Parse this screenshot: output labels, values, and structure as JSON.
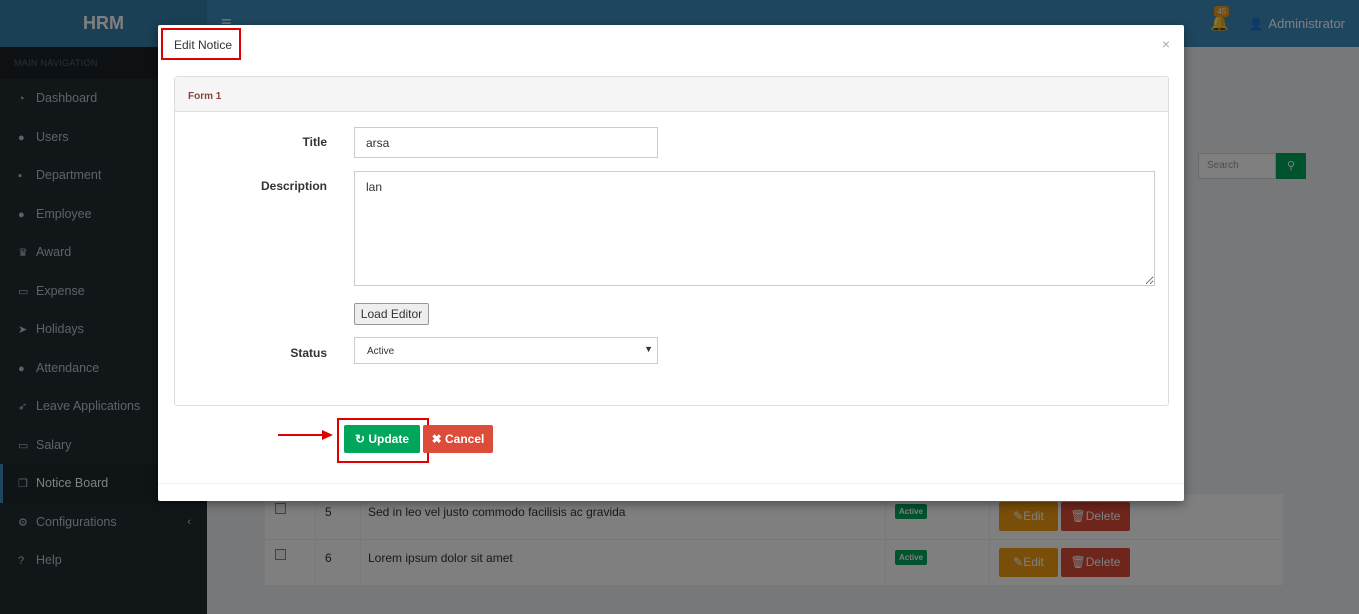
{
  "app": {
    "logo": "HRM"
  },
  "header": {
    "notifications_count": "45",
    "user_name": "Administrator"
  },
  "sidebar": {
    "section_title": "MAIN NAVIGATION",
    "items": [
      {
        "label": "Dashboard",
        "icon": "dashboard-icon"
      },
      {
        "label": "Users",
        "icon": "user-icon"
      },
      {
        "label": "Department",
        "icon": "briefcase-icon"
      },
      {
        "label": "Employee",
        "icon": "users-icon"
      },
      {
        "label": "Award",
        "icon": "trophy-icon"
      },
      {
        "label": "Expense",
        "icon": "money-icon"
      },
      {
        "label": "Holidays",
        "icon": "paper-plane-icon"
      },
      {
        "label": "Attendance",
        "icon": "user-icon"
      },
      {
        "label": "Leave Applications",
        "icon": "rocket-icon"
      },
      {
        "label": "Salary",
        "icon": "money-icon"
      },
      {
        "label": "Notice Board",
        "icon": "files-icon"
      },
      {
        "label": "Configurations",
        "icon": "cogs-icon"
      },
      {
        "label": "Help",
        "icon": "question-icon"
      }
    ]
  },
  "search": {
    "placeholder": "Search"
  },
  "table": {
    "rows": [
      {
        "num": "5",
        "title": "Sed in leo vel justo commodo facilisis ac gravida",
        "status": "Active",
        "edit": "Edit",
        "delete": "Delete"
      },
      {
        "num": "6",
        "title": "Lorem ipsum dolor sit amet",
        "status": "Active",
        "edit": "Edit",
        "delete": "Delete"
      }
    ]
  },
  "modal": {
    "title": "Edit Notice",
    "close": "×",
    "panel_title": "Form 1",
    "title_label": "Title",
    "title_value": "arsa",
    "description_label": "Description",
    "description_value": "lan",
    "load_editor_label": "Load Editor",
    "status_label": "Status",
    "status_value": "Active",
    "update_label": "Update",
    "cancel_label": "Cancel"
  },
  "colors": {
    "success": "#00a65a",
    "danger": "#dd4b39",
    "warning": "#f39c12",
    "header": "#3c8dbc",
    "annotation": "#e00000"
  }
}
